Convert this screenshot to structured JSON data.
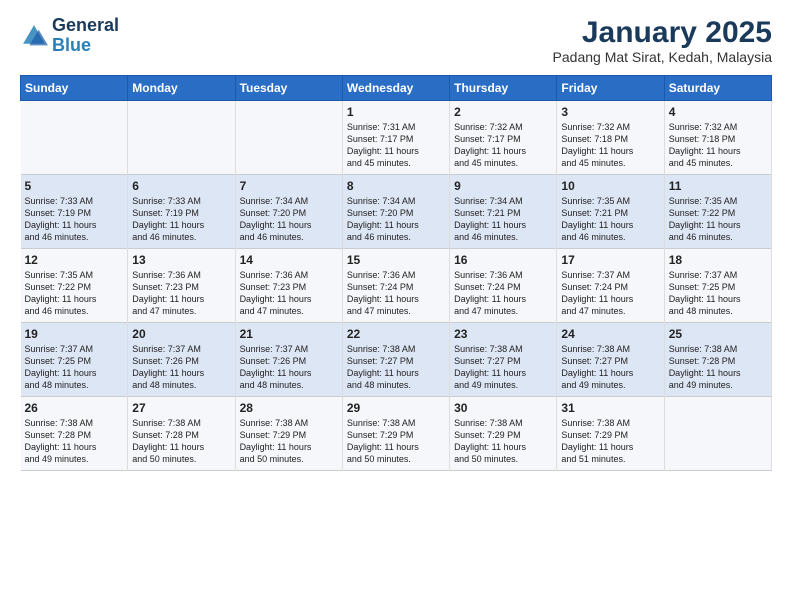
{
  "logo": {
    "line1": "General",
    "line2": "Blue"
  },
  "title": "January 2025",
  "subtitle": "Padang Mat Sirat, Kedah, Malaysia",
  "days_of_week": [
    "Sunday",
    "Monday",
    "Tuesday",
    "Wednesday",
    "Thursday",
    "Friday",
    "Saturday"
  ],
  "weeks": [
    [
      {
        "day": "",
        "content": ""
      },
      {
        "day": "",
        "content": ""
      },
      {
        "day": "",
        "content": ""
      },
      {
        "day": "1",
        "content": "Sunrise: 7:31 AM\nSunset: 7:17 PM\nDaylight: 11 hours\nand 45 minutes."
      },
      {
        "day": "2",
        "content": "Sunrise: 7:32 AM\nSunset: 7:17 PM\nDaylight: 11 hours\nand 45 minutes."
      },
      {
        "day": "3",
        "content": "Sunrise: 7:32 AM\nSunset: 7:18 PM\nDaylight: 11 hours\nand 45 minutes."
      },
      {
        "day": "4",
        "content": "Sunrise: 7:32 AM\nSunset: 7:18 PM\nDaylight: 11 hours\nand 45 minutes."
      }
    ],
    [
      {
        "day": "5",
        "content": "Sunrise: 7:33 AM\nSunset: 7:19 PM\nDaylight: 11 hours\nand 46 minutes."
      },
      {
        "day": "6",
        "content": "Sunrise: 7:33 AM\nSunset: 7:19 PM\nDaylight: 11 hours\nand 46 minutes."
      },
      {
        "day": "7",
        "content": "Sunrise: 7:34 AM\nSunset: 7:20 PM\nDaylight: 11 hours\nand 46 minutes."
      },
      {
        "day": "8",
        "content": "Sunrise: 7:34 AM\nSunset: 7:20 PM\nDaylight: 11 hours\nand 46 minutes."
      },
      {
        "day": "9",
        "content": "Sunrise: 7:34 AM\nSunset: 7:21 PM\nDaylight: 11 hours\nand 46 minutes."
      },
      {
        "day": "10",
        "content": "Sunrise: 7:35 AM\nSunset: 7:21 PM\nDaylight: 11 hours\nand 46 minutes."
      },
      {
        "day": "11",
        "content": "Sunrise: 7:35 AM\nSunset: 7:22 PM\nDaylight: 11 hours\nand 46 minutes."
      }
    ],
    [
      {
        "day": "12",
        "content": "Sunrise: 7:35 AM\nSunset: 7:22 PM\nDaylight: 11 hours\nand 46 minutes."
      },
      {
        "day": "13",
        "content": "Sunrise: 7:36 AM\nSunset: 7:23 PM\nDaylight: 11 hours\nand 47 minutes."
      },
      {
        "day": "14",
        "content": "Sunrise: 7:36 AM\nSunset: 7:23 PM\nDaylight: 11 hours\nand 47 minutes."
      },
      {
        "day": "15",
        "content": "Sunrise: 7:36 AM\nSunset: 7:24 PM\nDaylight: 11 hours\nand 47 minutes."
      },
      {
        "day": "16",
        "content": "Sunrise: 7:36 AM\nSunset: 7:24 PM\nDaylight: 11 hours\nand 47 minutes."
      },
      {
        "day": "17",
        "content": "Sunrise: 7:37 AM\nSunset: 7:24 PM\nDaylight: 11 hours\nand 47 minutes."
      },
      {
        "day": "18",
        "content": "Sunrise: 7:37 AM\nSunset: 7:25 PM\nDaylight: 11 hours\nand 48 minutes."
      }
    ],
    [
      {
        "day": "19",
        "content": "Sunrise: 7:37 AM\nSunset: 7:25 PM\nDaylight: 11 hours\nand 48 minutes."
      },
      {
        "day": "20",
        "content": "Sunrise: 7:37 AM\nSunset: 7:26 PM\nDaylight: 11 hours\nand 48 minutes."
      },
      {
        "day": "21",
        "content": "Sunrise: 7:37 AM\nSunset: 7:26 PM\nDaylight: 11 hours\nand 48 minutes."
      },
      {
        "day": "22",
        "content": "Sunrise: 7:38 AM\nSunset: 7:27 PM\nDaylight: 11 hours\nand 48 minutes."
      },
      {
        "day": "23",
        "content": "Sunrise: 7:38 AM\nSunset: 7:27 PM\nDaylight: 11 hours\nand 49 minutes."
      },
      {
        "day": "24",
        "content": "Sunrise: 7:38 AM\nSunset: 7:27 PM\nDaylight: 11 hours\nand 49 minutes."
      },
      {
        "day": "25",
        "content": "Sunrise: 7:38 AM\nSunset: 7:28 PM\nDaylight: 11 hours\nand 49 minutes."
      }
    ],
    [
      {
        "day": "26",
        "content": "Sunrise: 7:38 AM\nSunset: 7:28 PM\nDaylight: 11 hours\nand 49 minutes."
      },
      {
        "day": "27",
        "content": "Sunrise: 7:38 AM\nSunset: 7:28 PM\nDaylight: 11 hours\nand 50 minutes."
      },
      {
        "day": "28",
        "content": "Sunrise: 7:38 AM\nSunset: 7:29 PM\nDaylight: 11 hours\nand 50 minutes."
      },
      {
        "day": "29",
        "content": "Sunrise: 7:38 AM\nSunset: 7:29 PM\nDaylight: 11 hours\nand 50 minutes."
      },
      {
        "day": "30",
        "content": "Sunrise: 7:38 AM\nSunset: 7:29 PM\nDaylight: 11 hours\nand 50 minutes."
      },
      {
        "day": "31",
        "content": "Sunrise: 7:38 AM\nSunset: 7:29 PM\nDaylight: 11 hours\nand 51 minutes."
      },
      {
        "day": "",
        "content": ""
      }
    ]
  ]
}
